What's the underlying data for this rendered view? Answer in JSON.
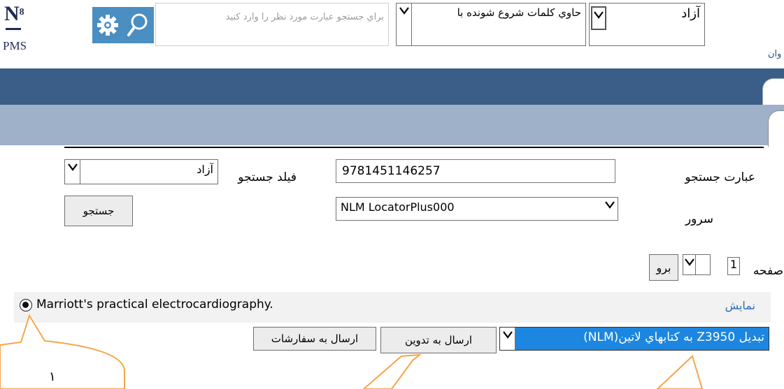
{
  "logo": {
    "mark": "N",
    "superscript": "8",
    "sub_text": "PMS"
  },
  "toolbar": {
    "settings_icon": "gear-icon",
    "search_icon": "magnifier-icon",
    "search_placeholder": "براي جستجو عبارت مورد نظر را وارد کنيد",
    "match_mode_value": "حاوي کلمات شروع شونده با",
    "field_value": "آزاد"
  },
  "side_label_fragment": "وان",
  "form": {
    "phrase_label": "عبارت جستجو",
    "phrase_value": "9781451146257",
    "field_label": "فيلد جستجو",
    "field_value": "آزاد",
    "server_label": "سرور",
    "server_value": "NLM LocatorPlus000",
    "search_button": "جستجو"
  },
  "pager": {
    "page_label": "صفحه",
    "page_value": "1",
    "go_button": "برو"
  },
  "result": {
    "title": "Marriott's practical electrocardiography.",
    "show_link": "نمايش",
    "selected": true
  },
  "actions": {
    "convert_value": "تبديل Z3950 به کتابهاي لاتين(NLM)",
    "send_catalog": "ارسال به تدوين",
    "send_orders": "ارسال به سفارشات"
  },
  "callouts": [
    {
      "label": "١",
      "color": "#f4a64a"
    },
    {
      "label": "",
      "color": "#f4a64a"
    },
    {
      "label": "",
      "color": "#f4a64a"
    }
  ]
}
